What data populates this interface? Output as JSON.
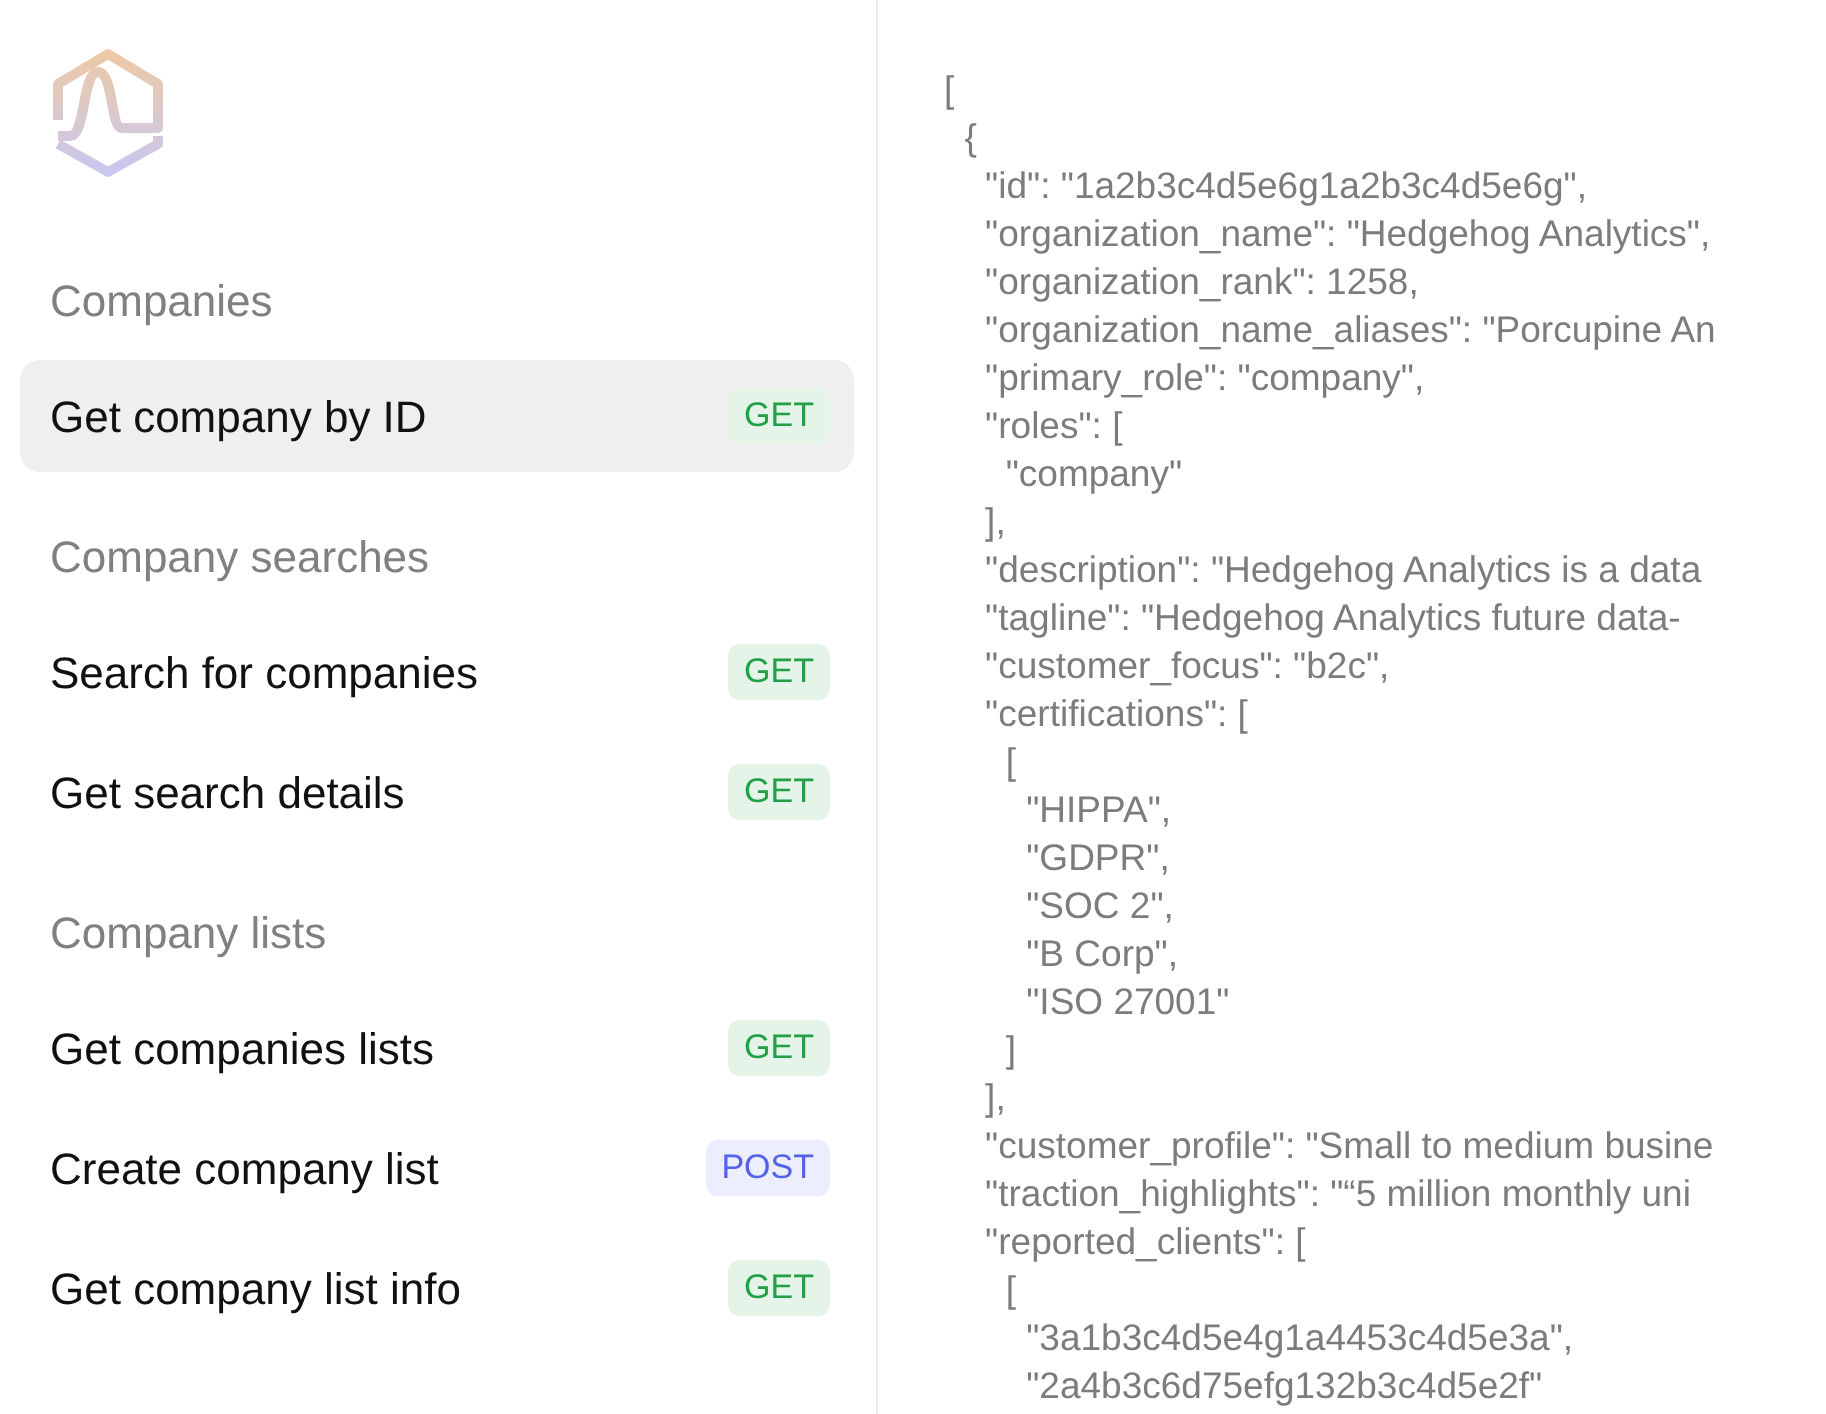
{
  "sidebar": {
    "sections": [
      {
        "title": "Companies",
        "items": [
          {
            "label": "Get company by ID",
            "method": "GET",
            "selected": true
          }
        ]
      },
      {
        "title": "Company searches",
        "items": [
          {
            "label": "Search for companies",
            "method": "GET",
            "selected": false
          },
          {
            "label": "Get search details",
            "method": "GET",
            "selected": false
          }
        ]
      },
      {
        "title": "Company lists",
        "items": [
          {
            "label": "Get companies lists",
            "method": "GET",
            "selected": false
          },
          {
            "label": "Create company list",
            "method": "POST",
            "selected": false
          },
          {
            "label": "Get company list info",
            "method": "GET",
            "selected": false
          }
        ]
      }
    ]
  },
  "response": {
    "lines": [
      "[",
      "  {",
      "    \"id\": \"1a2b3c4d5e6g1a2b3c4d5e6g\",",
      "    \"organization_name\": \"Hedgehog Analytics\",",
      "    \"organization_rank\": 1258,",
      "    \"organization_name_aliases\": \"Porcupine An",
      "    \"primary_role\": \"company\",",
      "    \"roles\": [",
      "      \"company\"",
      "    ],",
      "    \"description\": \"Hedgehog Analytics is a data",
      "    \"tagline\": \"Hedgehog Analytics future data-",
      "    \"customer_focus\": \"b2c\",",
      "    \"certifications\": [",
      "      [",
      "        \"HIPPA\",",
      "        \"GDPR\",",
      "        \"SOC 2\",",
      "        \"B Corp\",",
      "        \"ISO 27001\"",
      "      ]",
      "    ],",
      "    \"customer_profile\": \"Small to medium busine",
      "    \"traction_highlights\": \"“5 million monthly uni",
      "    \"reported_clients\": [",
      "      [",
      "        \"3a1b3c4d5e4g1a4453c4d5e3a\",",
      "        \"2a4b3c6d75efg132b3c4d5e2f\""
    ]
  }
}
